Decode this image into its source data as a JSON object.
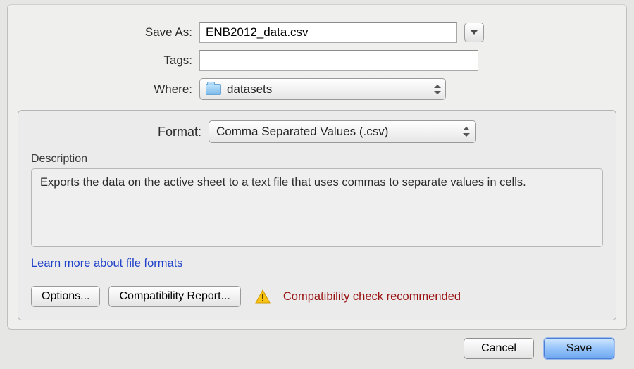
{
  "saveAs": {
    "label": "Save As:",
    "value": "ENB2012_data.csv"
  },
  "tags": {
    "label": "Tags:",
    "value": ""
  },
  "where": {
    "label": "Where:",
    "folder": "datasets"
  },
  "format": {
    "label": "Format:",
    "value": "Comma Separated Values (.csv)"
  },
  "description": {
    "header": "Description",
    "text": "Exports the data on the active sheet to a text file that uses commas to separate values in cells."
  },
  "link": {
    "label": "Learn more about file formats"
  },
  "buttons": {
    "options": "Options...",
    "compat": "Compatibility Report...",
    "cancel": "Cancel",
    "save": "Save"
  },
  "warning": {
    "text": "Compatibility check recommended"
  }
}
